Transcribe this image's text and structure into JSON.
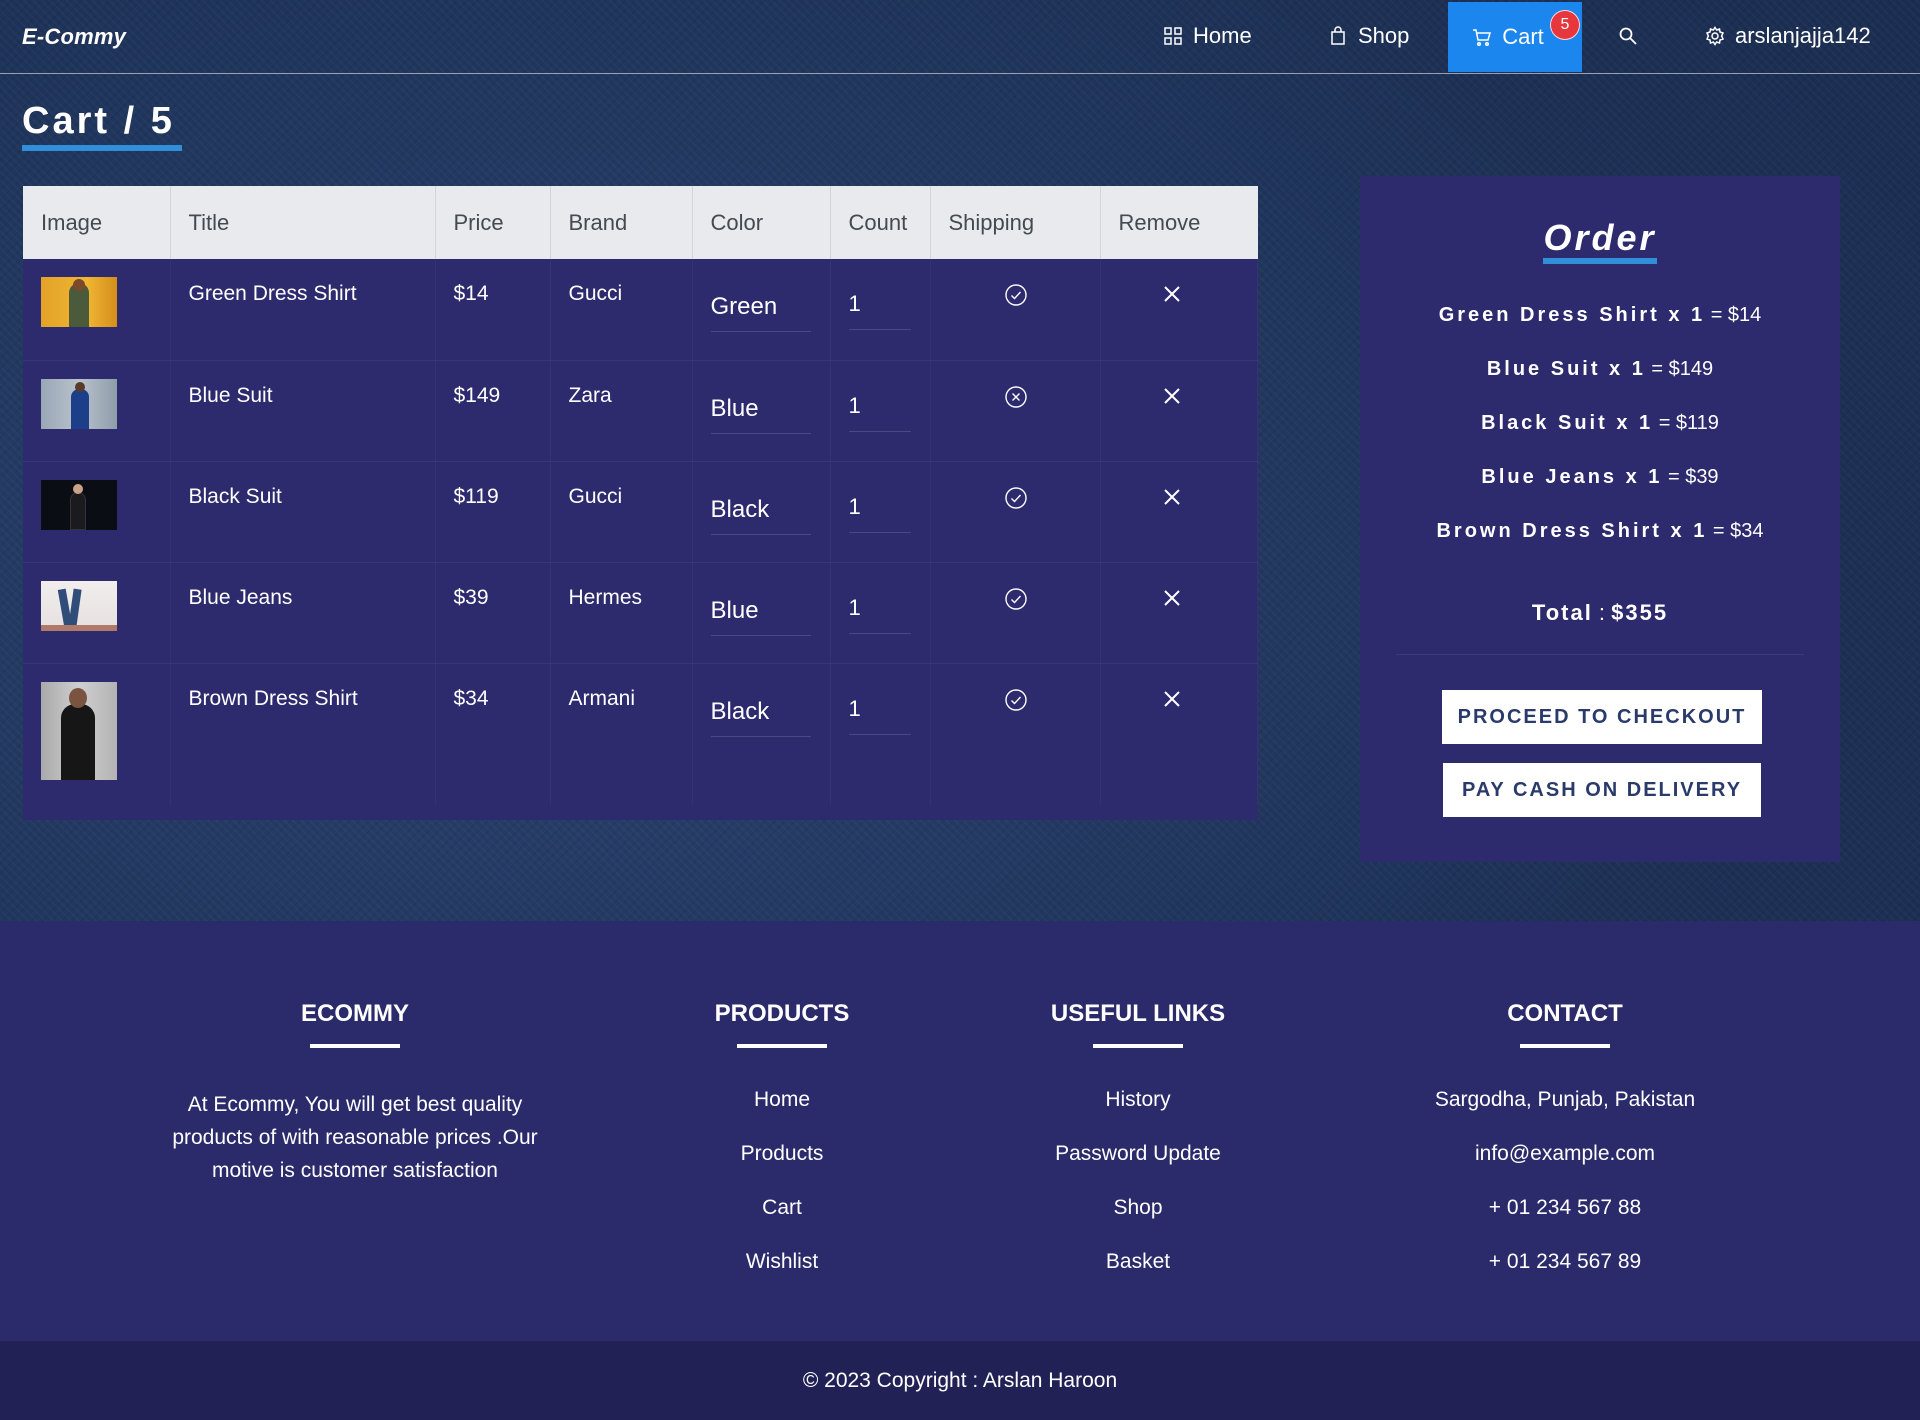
{
  "nav": {
    "brand": "E-Commy",
    "home": "Home",
    "shop": "Shop",
    "cart": "Cart",
    "cart_count": "5",
    "user": "arslanjajja142"
  },
  "heading": "Cart / 5",
  "table": {
    "headers": [
      "Image",
      "Title",
      "Price",
      "Brand",
      "Color",
      "Count",
      "Shipping",
      "Remove"
    ],
    "rows": [
      {
        "title": "Green Dress Shirt",
        "price": "$14",
        "brand": "Gucci",
        "color": "Green",
        "count": "1",
        "shipping": "check-circle-icon"
      },
      {
        "title": "Blue Suit",
        "price": "$149",
        "brand": "Zara",
        "color": "Blue",
        "count": "1",
        "shipping": "x-circle-icon"
      },
      {
        "title": "Black Suit",
        "price": "$119",
        "brand": "Gucci",
        "color": "Black",
        "count": "1",
        "shipping": "check-circle-icon"
      },
      {
        "title": "Blue Jeans",
        "price": "$39",
        "brand": "Hermes",
        "color": "Blue",
        "count": "1",
        "shipping": "check-circle-icon"
      },
      {
        "title": "Brown Dress Shirt",
        "price": "$34",
        "brand": "Armani",
        "color": "Black",
        "count": "1",
        "shipping": "check-circle-icon"
      }
    ]
  },
  "order": {
    "title": "Order",
    "lines": [
      {
        "item": "Green Dress Shirt x 1",
        "amount": "= $14"
      },
      {
        "item": "Blue Suit x 1",
        "amount": "= $149"
      },
      {
        "item": "Black Suit x 1",
        "amount": "= $119"
      },
      {
        "item": "Blue Jeans x 1",
        "amount": "= $39"
      },
      {
        "item": "Brown Dress Shirt x 1",
        "amount": "= $34"
      }
    ],
    "total_label": "Total",
    "total_sep": " : ",
    "total_value": "$355",
    "checkout_btn": "PROCEED TO CHECKOUT",
    "cod_btn": "PAY CASH ON DELIVERY"
  },
  "footer": {
    "ecommy_title": "ECOMMY",
    "ecommy_text": "At Ecommy, You will get best quality products of with reasonable prices .Our motive is customer satisfaction",
    "products_title": "PRODUCTS",
    "products_links": [
      "Home",
      "Products",
      "Cart",
      "Wishlist"
    ],
    "useful_title": "USEFUL LINKS",
    "useful_links": [
      "History",
      "Password Update",
      "Shop",
      "Basket"
    ],
    "contact_title": "CONTACT",
    "contact_items": [
      "Sargodha, Punjab, Pakistan",
      "info@example.com",
      "+ 01 234 567 88",
      "+ 01 234 567 89"
    ],
    "copyright": "© 2023 Copyright : Arslan Haroon"
  },
  "colors": {
    "accent": "#1b86ee",
    "panel": "#2d2a6d",
    "badge": "#e8363d",
    "underline": "#2f8fd9"
  }
}
